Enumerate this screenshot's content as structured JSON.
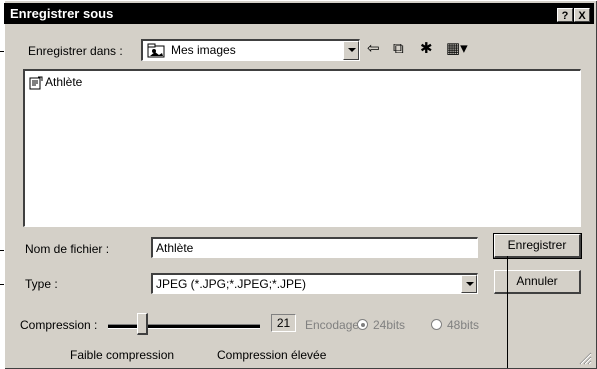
{
  "window": {
    "title": "Enregistrer sous"
  },
  "titlebar_buttons": {
    "help": "?",
    "close": "X"
  },
  "save_in": {
    "label": "Enregistrer dans :",
    "value": "Mes images"
  },
  "files": [
    {
      "name": "Athlète"
    }
  ],
  "filename": {
    "label": "Nom de fichier :",
    "value": "Athlète"
  },
  "type": {
    "label": "Type :",
    "value": "JPEG (*.JPG;*.JPEG;*.JPE)"
  },
  "buttons": {
    "save": "Enregistrer",
    "cancel": "Annuler"
  },
  "compression": {
    "label": "Compression :",
    "value": "21",
    "encoding_label": "Encodage",
    "option_24": "24bits",
    "option_48": "48bits",
    "low_label": "Faible compression",
    "high_label": "Compression élevée"
  }
}
